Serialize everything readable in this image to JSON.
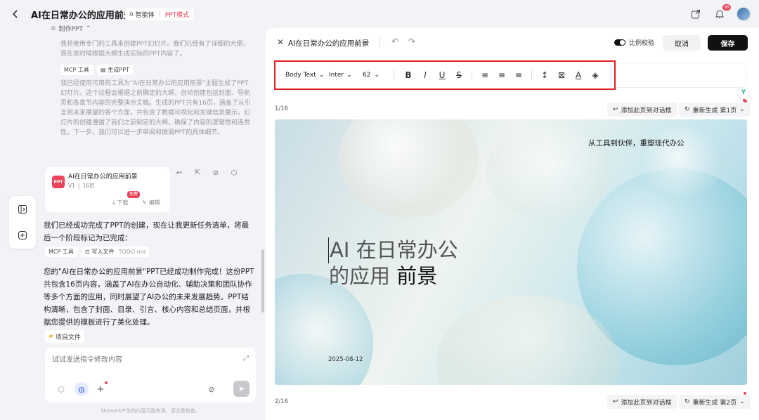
{
  "header": {
    "title": "AI在日常办公的应用前景",
    "agent_label": "智能体",
    "mode_label": "PPT模式",
    "notification_count": "99"
  },
  "chat": {
    "collapsed_step": "制作PPT",
    "thinking_1": "我将使用专门的工具来创建PPT幻灯片。我们已经有了详细的大纲，现在是时候根据大纲生成实际的PPT内容了。",
    "tool_chip_1": "MCP 工具",
    "tool_chip_2": "生成PPT",
    "thinking_2": "我已经使用可用的工具为\"AI在日常办公的应用前景\"主题生成了PPT幻灯片。这个过程会根据之前确定的大纲，自动创建包括封面、导航页和各章节内容的完整演示文稿。生成的PPT共有16页，涵盖了从引言到未来展望的各个方面，并包含了数据可视化和关键信息展示。幻灯片的创建遵循了我们之前制定的大纲，确保了内容的逻辑性和连贯性。下一步，我们可以进一步审阅和微调PPT的具体细节。",
    "ppt_card": {
      "logo": "PPT",
      "title": "AI在日常办公的应用前景",
      "version": "V1",
      "pages": "16页",
      "free_badge": "免费",
      "download": "下载",
      "edit": "编辑"
    },
    "message_1": "我们已经成功完成了PPT的创建，现在让我更新任务清单，将最后一个阶段标记为已完成：",
    "tool_chip_3": "MCP 工具",
    "tool_chip_4": "写入文件",
    "file_name": "TODO.md",
    "message_2": "您的\"AI在日常办公的应用前景\"PPT已经成功制作完成！这份PPT共包含16页内容，涵盖了AI在办公自动化、辅助决策和团队协作等多个方面的应用，同时展望了AI办公的未来发展趋势。PPT结构清晰，包含了封面、目录、引言、核心内容和总结页面，并根据您提供的模板进行了美化处理。",
    "project_files": "项目文件",
    "input_placeholder": "试试发送指令修改内容",
    "footer_note": "Skywork产生的内容可能有误，请注意核查。"
  },
  "editor": {
    "title": "AI在日常办公的应用前景",
    "ratio_toggle_label": "比例校验",
    "cancel": "取消",
    "save": "保存",
    "toolbar": {
      "style": "Body Text",
      "font": "Inter",
      "size": "62"
    },
    "page_1_indicator": "1/16",
    "page_2_indicator": "2/16",
    "add_to_chat": "添加此页到对话框",
    "regen_1": "重新生成 第1页",
    "regen_2": "重新生成 第2页",
    "slide": {
      "tagline": "从工具到伙伴，重塑现代办公",
      "title_line1": "AI 在日常办公",
      "title_line2_a": "的应用 ",
      "title_line2_b": "前景",
      "date": "2025-08-12"
    }
  },
  "colors": {
    "accent_red": "#e9445a",
    "toolbar_highlight": "#e02020",
    "save_button": "#111111"
  }
}
